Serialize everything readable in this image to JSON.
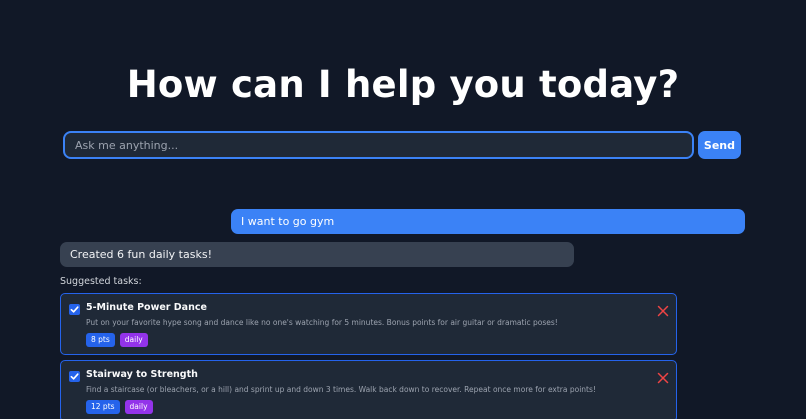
{
  "hero": {
    "title": "How can I help you today?"
  },
  "ask": {
    "placeholder": "Ask me anything...",
    "value": "",
    "send_label": "Send"
  },
  "chat": {
    "user_message": "I want to go gym",
    "bot_message": "Created 6 fun daily tasks!"
  },
  "suggested": {
    "label": "Suggested tasks:",
    "tasks": [
      {
        "title": "5-Minute Power Dance",
        "description": "Put on your favorite hype song and dance like no one's watching for 5 minutes. Bonus points for air guitar or dramatic poses!",
        "points": "8 pts",
        "frequency": "daily",
        "checked": true
      },
      {
        "title": "Stairway to Strength",
        "description": "Find a staircase (or bleachers, or a hill) and sprint up and down 3 times. Walk back down to recover. Repeat once more for extra points!",
        "points": "12 pts",
        "frequency": "daily",
        "checked": true
      }
    ]
  },
  "colors": {
    "background": "#111827",
    "accent": "#3b82f6",
    "card": "#1f2937",
    "tag_points": "#2563eb",
    "tag_frequency": "#9333ea",
    "close": "#ef4444"
  },
  "icons": {
    "checkbox": "checkbox-checked-icon",
    "close": "close-icon"
  }
}
